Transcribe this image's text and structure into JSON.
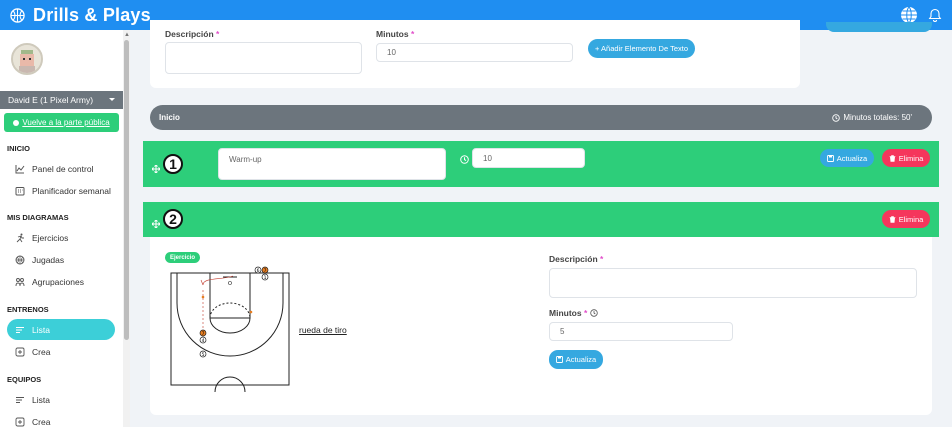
{
  "app": {
    "title": "Drills & Plays"
  },
  "sidebar": {
    "user": "David E (1 Pixel Army)",
    "public_button": "Vuelve a la parte pública",
    "sections": {
      "inicio": "INICIO",
      "diagramas": "MIS DIAGRAMAS",
      "entrenos": "ENTRENOS",
      "equipos": "EQUIPOS"
    },
    "items": {
      "panel": "Panel de control",
      "planificador": "Planificador semanal",
      "ejercicios": "Ejercicios",
      "jugadas": "Jugadas",
      "agrupaciones": "Agrupaciones",
      "lista_entrenos": "Lista",
      "crea_entrenos": "Crea",
      "lista_equipos": "Lista",
      "crea_equipos": "Crea"
    }
  },
  "text_element_form": {
    "description_label": "Descripción",
    "minutes_label": "Minutos",
    "required_mark": "*",
    "minutes_value": "10",
    "add_button": "+ Añadir Elemento De Texto"
  },
  "session_header": {
    "title": "Inicio",
    "total": "Minutos totales: 50'"
  },
  "row1": {
    "number": "1",
    "text_value": "Warm-up",
    "minutes_value": "10",
    "update_button": "Actualiza",
    "delete_button": "Elimina"
  },
  "row2": {
    "number": "2",
    "delete_button": "Elimina",
    "badge": "Ejercicio",
    "exercise_name": "rueda de tiro",
    "description_label": "Descripción",
    "minutes_label": "Minutos",
    "required_mark": "*",
    "minutes_value": "5",
    "update_button": "Actualiza"
  },
  "court_labels": {
    "p6": "6",
    "p7": "7",
    "p1": "1",
    "p4": "4",
    "p5": "5",
    "p7b": "7",
    "o": "O"
  },
  "colors": {
    "topbar": "#1f8ef1",
    "green": "#2dce7a",
    "gray_bar": "#6c757d",
    "blue_pill": "#35a8e0",
    "red_pill": "#f5365c",
    "active_nav": "#3ccfd8"
  }
}
